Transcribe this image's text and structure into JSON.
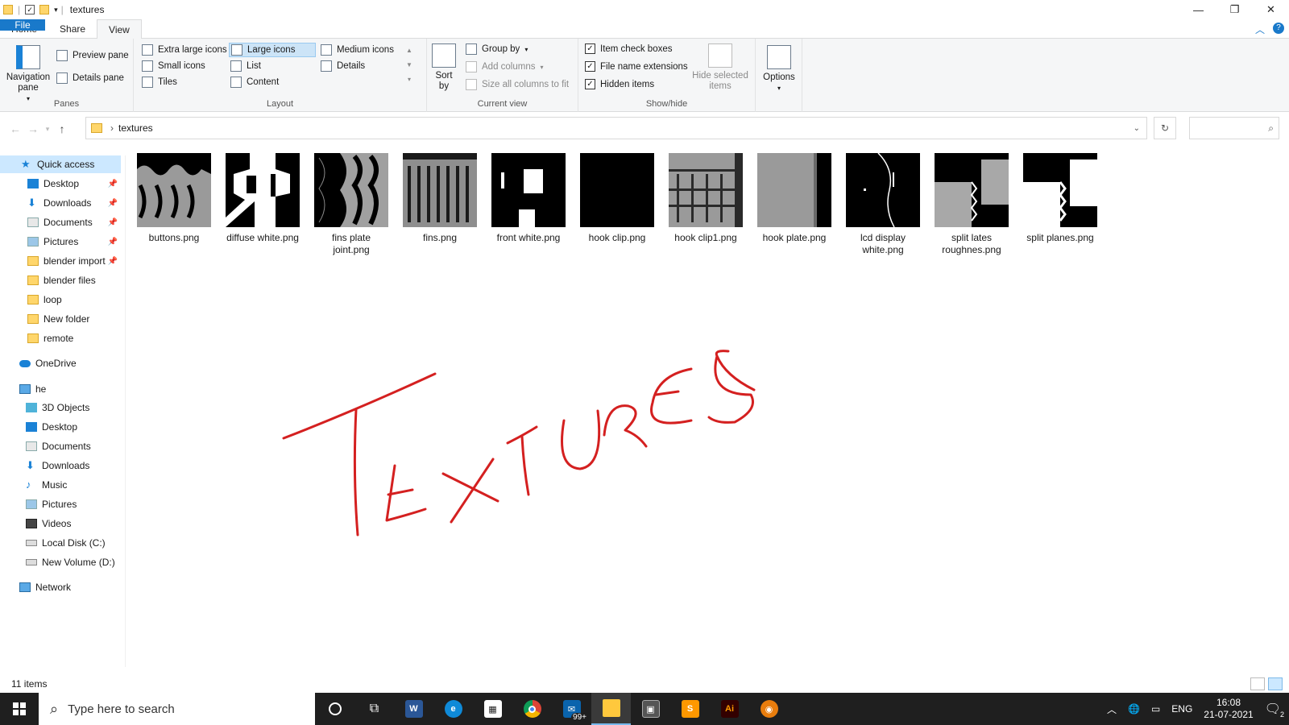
{
  "window": {
    "title": "textures"
  },
  "ribbon_tabs": [
    {
      "label": "File"
    },
    {
      "label": "Home"
    },
    {
      "label": "Share"
    },
    {
      "label": "View"
    }
  ],
  "ribbon": {
    "panes": {
      "navigation_pane": "Navigation pane",
      "preview_pane": "Preview pane",
      "details_pane": "Details pane",
      "group_label": "Panes"
    },
    "layout": {
      "options": [
        "Extra large icons",
        "Large icons",
        "Medium icons",
        "Small icons",
        "List",
        "Details",
        "Tiles",
        "Content"
      ],
      "selected": "Large icons",
      "group_label": "Layout"
    },
    "current_view": {
      "sort_by": "Sort by",
      "group_by": "Group by",
      "add_columns": "Add columns",
      "size_all_columns": "Size all columns to fit",
      "group_label": "Current view"
    },
    "show_hide": {
      "item_check_boxes": "Item check boxes",
      "file_name_extensions": "File name extensions",
      "hidden_items": "Hidden items",
      "hide_selected_items": "Hide selected items",
      "group_label": "Show/hide"
    },
    "options": "Options"
  },
  "address": {
    "path": "textures",
    "search_placeholder": ""
  },
  "nav_pane": {
    "quick_access": "Quick access",
    "quick_items": [
      "Desktop",
      "Downloads",
      "Documents",
      "Pictures",
      "blender import",
      "blender files",
      "loop",
      "New folder",
      "remote"
    ],
    "onedrive": "OneDrive",
    "pc": "he",
    "pc_items": [
      "3D Objects",
      "Desktop",
      "Documents",
      "Downloads",
      "Music",
      "Pictures",
      "Videos",
      "Local Disk (C:)",
      "New Volume (D:)"
    ],
    "network": "Network"
  },
  "files": [
    {
      "line1": "buttons.png",
      "line2": ""
    },
    {
      "line1": "diffuse white.png",
      "line2": ""
    },
    {
      "line1": "fins plate",
      "line2": "joint.png"
    },
    {
      "line1": "fins.png",
      "line2": ""
    },
    {
      "line1": "front white.png",
      "line2": ""
    },
    {
      "line1": "hook clip.png",
      "line2": ""
    },
    {
      "line1": "hook clip1.png",
      "line2": ""
    },
    {
      "line1": "hook plate.png",
      "line2": ""
    },
    {
      "line1": "lcd display",
      "line2": "white.png"
    },
    {
      "line1": "split lates",
      "line2": "roughnes.png"
    },
    {
      "line1": "split planes.png",
      "line2": ""
    }
  ],
  "annotation": {
    "text": "TEXTURES",
    "color": "#d42020"
  },
  "status": {
    "item_count": "11 items"
  },
  "taskbar": {
    "search_placeholder": "Type here to search",
    "mail_badge": "99+",
    "language": "ENG",
    "time": "16:08",
    "date": "21-07-2021",
    "notification_count": "2"
  }
}
